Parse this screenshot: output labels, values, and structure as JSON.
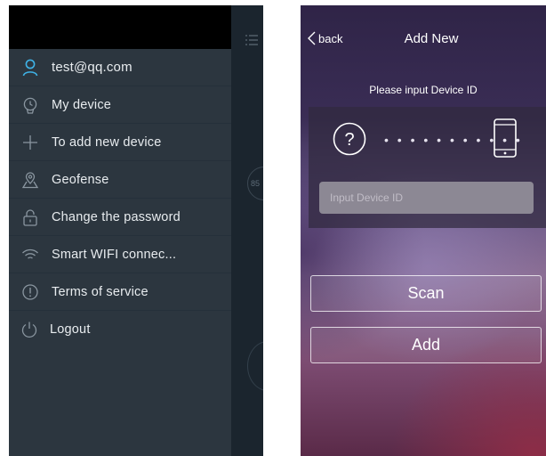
{
  "left_screen": {
    "user": {
      "email": "test@qq.com"
    },
    "menu": [
      {
        "label": "My device",
        "icon": "watch-icon"
      },
      {
        "label": "To add new device",
        "icon": "plus-icon"
      },
      {
        "label": "Geofense",
        "icon": "map-pin-icon"
      },
      {
        "label": "Change the password",
        "icon": "lock-icon"
      },
      {
        "label": "Smart WIFI connec...",
        "icon": "wifi-icon"
      },
      {
        "label": "Terms of service",
        "icon": "info-icon"
      },
      {
        "label": "Logout",
        "icon": "power-icon"
      }
    ],
    "peek": {
      "gauge_text": "85"
    },
    "colors": {
      "accent": "#3fb2e6",
      "drawer_bg": "#2c363f",
      "status_bar": "#000000"
    }
  },
  "right_screen": {
    "nav": {
      "back_label": "back",
      "title": "Add New"
    },
    "prompt": "Please input Device ID",
    "dots": "• • • • • • • • • • •",
    "input": {
      "placeholder": "Input Device ID",
      "value": ""
    },
    "buttons": {
      "scan": "Scan",
      "add": "Add"
    }
  }
}
